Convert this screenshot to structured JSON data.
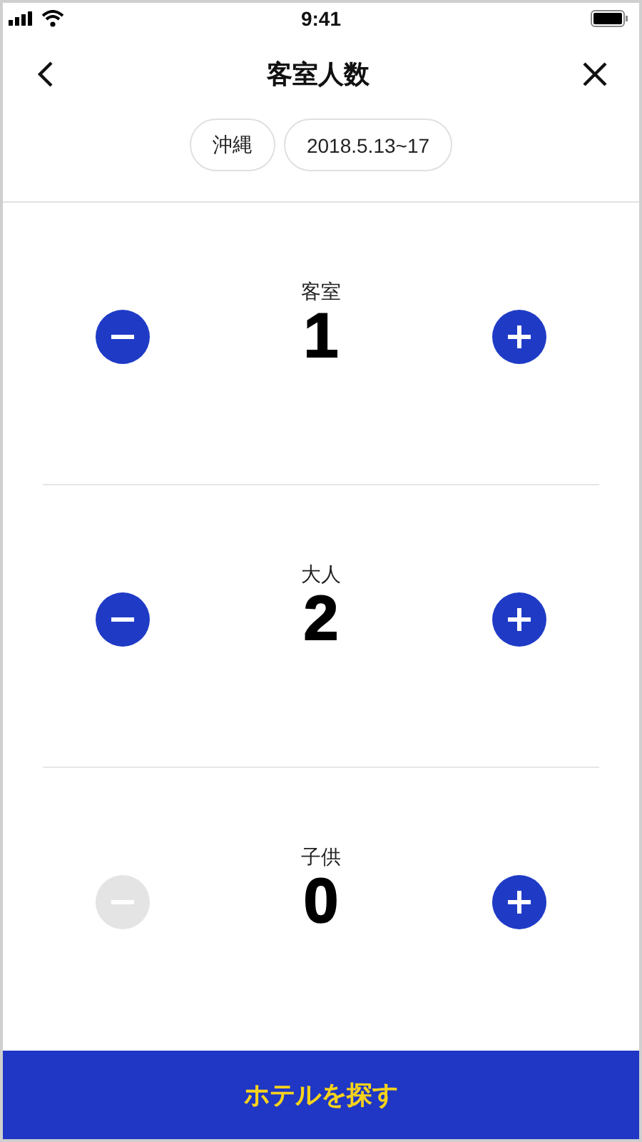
{
  "status_bar": {
    "time": "9:41"
  },
  "header": {
    "title": "客室人数"
  },
  "chips": [
    "沖縄",
    "2018.5.13~17"
  ],
  "counters": [
    {
      "label": "客室",
      "value": "1",
      "minus_disabled": false,
      "plus_disabled": false
    },
    {
      "label": "大人",
      "value": "2",
      "minus_disabled": false,
      "plus_disabled": false
    },
    {
      "label": "子供",
      "value": "0",
      "minus_disabled": true,
      "plus_disabled": false
    }
  ],
  "search_button": {
    "label": "ホテルを探す"
  }
}
